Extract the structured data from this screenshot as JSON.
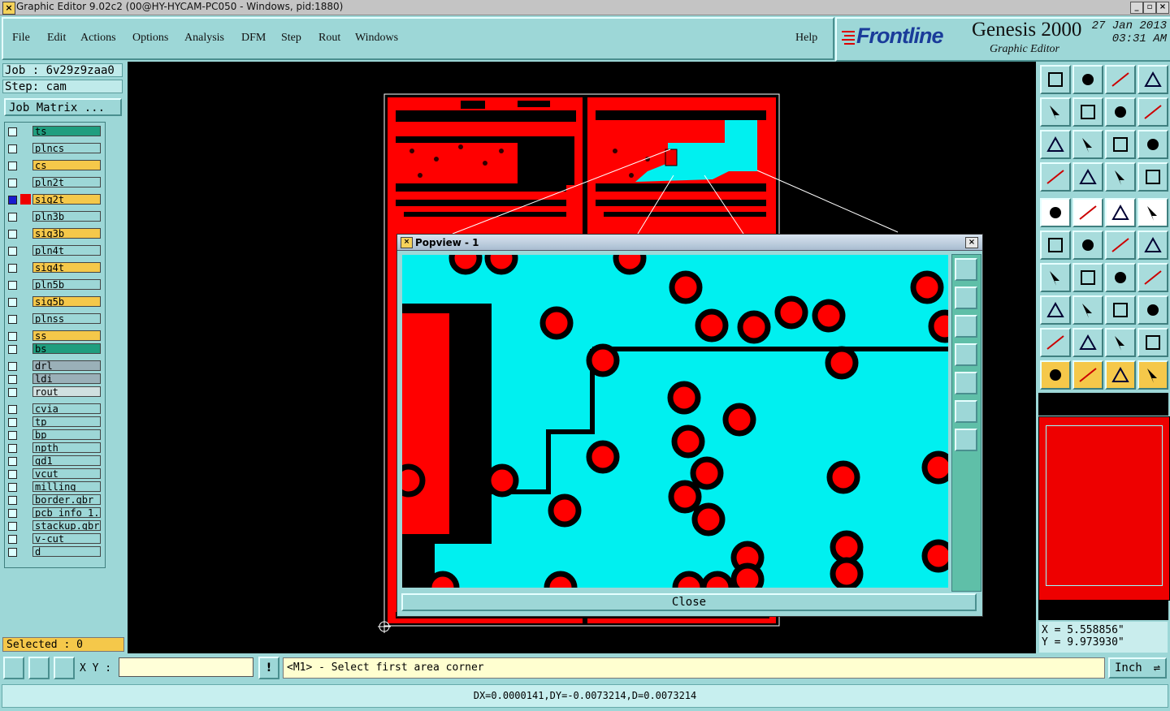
{
  "window": {
    "title": "Graphic Editor 9.02c2 (00@HY-HYCAM-PC050 - Windows, pid:1880)"
  },
  "menu": [
    "File",
    "Edit",
    "Actions",
    "Options",
    "Analysis",
    "DFM",
    "Step",
    "Rout",
    "Windows"
  ],
  "help": "Help",
  "brand": {
    "logo": "Frontline",
    "product": "Genesis 2000",
    "subtitle": "Graphic Editor",
    "date": "27 Jan 2013",
    "time": "03:31 AM"
  },
  "job": {
    "job": "Job : 6v29z9zaa0",
    "step": "Step: cam",
    "matrix_button": "Job Matrix ..."
  },
  "layers": [
    {
      "name": "ts",
      "color": "#1f9e7f"
    },
    {
      "name": "plncs",
      "color": "#9dd7d7"
    },
    {
      "name": "cs",
      "color": "#f5c84a"
    },
    {
      "name": "pln2t",
      "color": "#9dd7d7"
    },
    {
      "name": "sig2t",
      "color": "#f5c84a",
      "active": true
    },
    {
      "name": "pln3b",
      "color": "#9dd7d7"
    },
    {
      "name": "sig3b",
      "color": "#f5c84a"
    },
    {
      "name": "pln4t",
      "color": "#9dd7d7"
    },
    {
      "name": "sig4t",
      "color": "#f5c84a"
    },
    {
      "name": "pln5b",
      "color": "#9dd7d7"
    },
    {
      "name": "sig5b",
      "color": "#f5c84a"
    },
    {
      "name": "plnss",
      "color": "#9dd7d7"
    },
    {
      "name": "ss",
      "color": "#f5c84a"
    },
    {
      "name": "bs",
      "color": "#1f9e7f"
    },
    {
      "name": "drl",
      "color": "#9ab0b8"
    },
    {
      "name": "ldi",
      "color": "#9ab0b8"
    },
    {
      "name": "rout",
      "color": "#d0e0e0"
    },
    {
      "name": "cvia",
      "color": "#9dd7d7"
    },
    {
      "name": "tp",
      "color": "#9dd7d7"
    },
    {
      "name": "bp",
      "color": "#9dd7d7"
    },
    {
      "name": "npth",
      "color": "#9dd7d7"
    },
    {
      "name": "gd1",
      "color": "#9dd7d7"
    },
    {
      "name": "vcut",
      "color": "#9dd7d7"
    },
    {
      "name": "milling",
      "color": "#9dd7d7"
    },
    {
      "name": "border.gbr",
      "color": "#9dd7d7"
    },
    {
      "name": "pcb_info_1.g",
      "color": "#9dd7d7"
    },
    {
      "name": "stackup.gbr",
      "color": "#9dd7d7"
    },
    {
      "name": "v-cut",
      "color": "#9dd7d7"
    },
    {
      "name": "d",
      "color": "#9dd7d7"
    }
  ],
  "selected": "Selected : 0",
  "popview": {
    "title": "Popview - 1",
    "close": "Close"
  },
  "coords": {
    "x": "X = 5.558856\"",
    "y": "Y = 9.973930\""
  },
  "bottom": {
    "xy_label": "X Y :",
    "xy_value": "",
    "exclaim": "!",
    "message": "<M1> - Select first area corner",
    "unit": "Inch"
  },
  "status": "DX=0.0000141,DY=-0.0073214,D=0.0073214",
  "colors": {
    "copper": "#ff0000",
    "highlight": "#00f0f0",
    "panel": "#9dd7d7",
    "background": "#000000"
  }
}
